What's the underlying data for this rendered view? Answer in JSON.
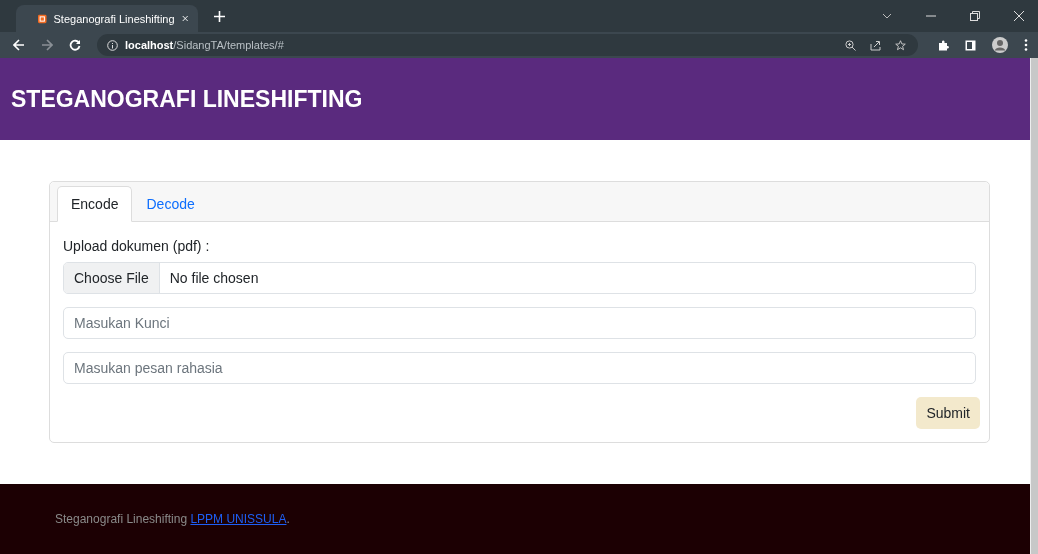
{
  "browser": {
    "tab_title": "Steganografi Lineshifting",
    "address": "**localhost**/SidangTA/templates/#"
  },
  "header": {
    "title": "STEGANOGRAFI LINESHIFTING"
  },
  "tabs": [
    {
      "label": "Encode",
      "selected": true
    },
    {
      "label": "Decode",
      "selected": false
    }
  ],
  "form": {
    "upload_label": "Upload dokumen (pdf) :",
    "file_button": "Choose File",
    "file_status": "No file chosen",
    "fields": [
      {
        "placeholder": "Masukan Kunci"
      },
      {
        "placeholder": "Masukan pesan rahasia"
      }
    ],
    "submit": "Submit"
  },
  "footer": {
    "text": "Steganografi Lineshifting",
    "link": "LPPM UNISSULA",
    "suffix": "."
  }
}
